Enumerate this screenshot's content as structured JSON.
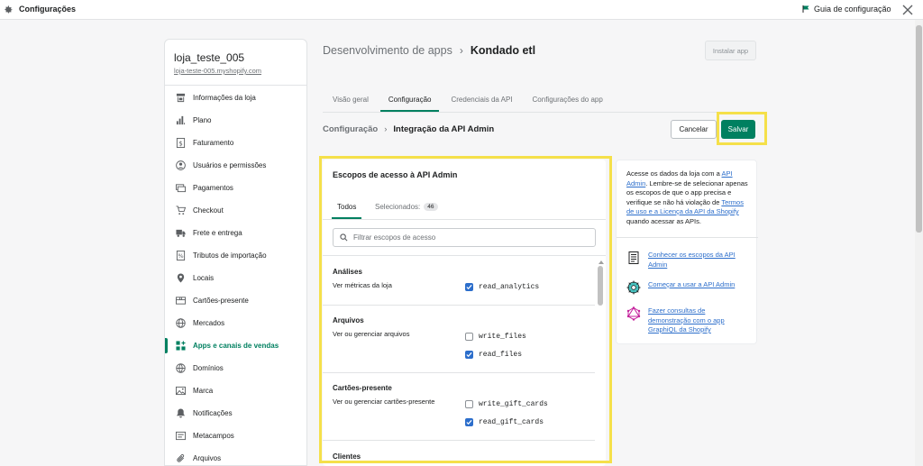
{
  "topbar": {
    "title": "Configurações",
    "guide_label": "Guia de configuração"
  },
  "store": {
    "name": "loja_teste_005",
    "url": "loja-teste-005.myshopify.com"
  },
  "sidebar": {
    "items": [
      {
        "label": "Informações da loja",
        "icon": "store-icon"
      },
      {
        "label": "Plano",
        "icon": "plan-icon"
      },
      {
        "label": "Faturamento",
        "icon": "billing-icon"
      },
      {
        "label": "Usuários e permissões",
        "icon": "user-icon"
      },
      {
        "label": "Pagamentos",
        "icon": "payments-icon"
      },
      {
        "label": "Checkout",
        "icon": "cart-icon"
      },
      {
        "label": "Frete e entrega",
        "icon": "truck-icon"
      },
      {
        "label": "Tributos de importação",
        "icon": "duties-icon"
      },
      {
        "label": "Locais",
        "icon": "location-icon"
      },
      {
        "label": "Cartões-presente",
        "icon": "gift-card-icon"
      },
      {
        "label": "Mercados",
        "icon": "globe-icon"
      },
      {
        "label": "Apps e canais de vendas",
        "icon": "apps-icon",
        "active": true
      },
      {
        "label": "Domínios",
        "icon": "domain-icon"
      },
      {
        "label": "Marca",
        "icon": "brand-icon"
      },
      {
        "label": "Notificações",
        "icon": "bell-icon"
      },
      {
        "label": "Metacampos",
        "icon": "metafields-icon"
      },
      {
        "label": "Arquivos",
        "icon": "paperclip-icon"
      }
    ]
  },
  "header": {
    "parent": "Desenvolvimento de apps",
    "separator": "›",
    "current": "Kondado etl",
    "install_label": "Instalar app"
  },
  "tabs": [
    {
      "label": "Visão geral"
    },
    {
      "label": "Configuração",
      "active": true
    },
    {
      "label": "Credenciais da API"
    },
    {
      "label": "Configurações do app"
    }
  ],
  "subheader": {
    "parent": "Configuração",
    "separator": "›",
    "current": "Integração da API Admin",
    "cancel_label": "Cancelar",
    "save_label": "Salvar"
  },
  "scopes": {
    "title": "Escopos de acesso à API Admin",
    "tab_all": "Todos",
    "tab_selected": "Selecionados:",
    "selected_count": "46",
    "filter_placeholder": "Filtrar escopos de acesso",
    "sections": [
      {
        "title": "Análises",
        "desc": "Ver métricas da loja",
        "perms": [
          {
            "name": "read_analytics",
            "checked": true
          }
        ]
      },
      {
        "title": "Arquivos",
        "desc": "Ver ou gerenciar arquivos",
        "perms": [
          {
            "name": "write_files",
            "checked": false
          },
          {
            "name": "read_files",
            "checked": true
          }
        ]
      },
      {
        "title": "Cartões-presente",
        "desc": "Ver ou gerenciar cartões-presente",
        "perms": [
          {
            "name": "write_gift_cards",
            "checked": false
          },
          {
            "name": "read_gift_cards",
            "checked": true
          }
        ]
      },
      {
        "title": "Clientes",
        "desc": "",
        "perms": []
      }
    ]
  },
  "info": {
    "text_1": "Acesse os dados da loja com a ",
    "link_api": "API Admin",
    "text_2": ". Lembre-se de selecionar apenas os escopos de que o app precisa e verifique se não há violação de ",
    "link_terms": "Termos de uso e a Licença da API da Shopify",
    "text_3": " quando acessar as APIs.",
    "links": [
      {
        "label": "Conhecer os escopos da API Admin",
        "icon": "document-icon"
      },
      {
        "label": "Começar a usar a API Admin",
        "icon": "gear-cluster-icon"
      },
      {
        "label": "Fazer consultas de demonstração com o app GraphiQL da Shopify",
        "icon": "graphql-icon"
      }
    ]
  },
  "colors": {
    "accent": "#008060",
    "link": "#2c6ecb",
    "highlight": "#f5e04a"
  }
}
